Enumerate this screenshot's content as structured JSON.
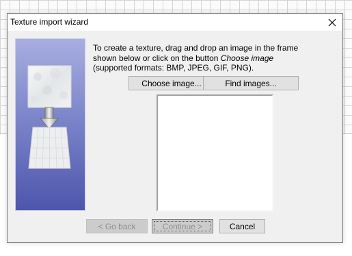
{
  "window": {
    "title": "Texture import wizard",
    "close_icon": "close-icon"
  },
  "instructions": {
    "line1": "To create a texture, drag and drop an image in the frame",
    "line2_prefix": "shown below or click on the button ",
    "line2_emphasis": "Choose image",
    "line3": "(supported formats: BMP, JPEG, GIF, PNG)."
  },
  "buttons": {
    "choose_image": "Choose image...",
    "find_images": "Find images...",
    "go_back": "< Go back",
    "continue": "Continue >",
    "cancel": "Cancel"
  },
  "button_states": {
    "go_back_enabled": false,
    "continue_enabled": false,
    "cancel_enabled": true
  },
  "colors": {
    "side_panel_top": "#a7aee0",
    "side_panel_bottom": "#4d56ab",
    "dialog_bg": "#f0f0f0",
    "disabled_text": "#8f8f8f"
  }
}
